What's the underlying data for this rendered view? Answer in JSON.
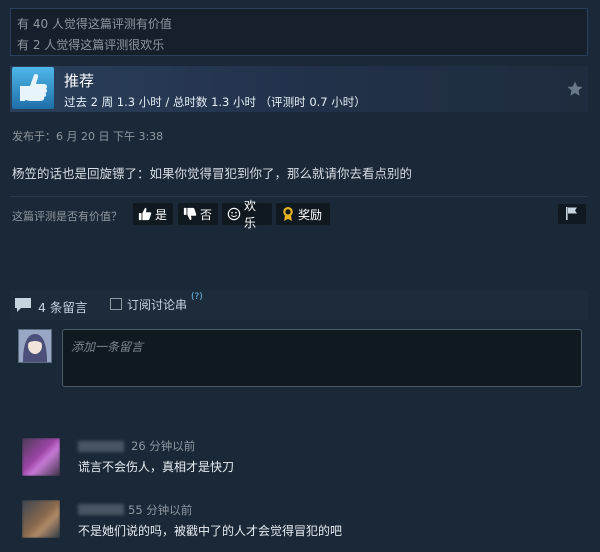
{
  "helpful_summary": {
    "line1": "有 40 人觉得这篇评测有价值",
    "line2": "有 2 人觉得这篇评测很欢乐"
  },
  "review": {
    "recommendation": "推荐",
    "hours": "过去 2 周 1.3 小时 / 总时数 1.3 小时 （评测时 0.7 小时）",
    "posted": "发布于：6 月 20 日 下午 3:38",
    "text": "杨笠的话也是回旋镖了：如果你觉得冒犯到你了，那么就请你去看点别的",
    "icons": {
      "thumb": "thumbs-up-icon",
      "award": "star-icon"
    }
  },
  "rating": {
    "question": "这篇评测是否有价值？",
    "yes": "是",
    "no": "否",
    "funny": "欢乐",
    "award": "奖励"
  },
  "comments": {
    "count_label": "4 条留言",
    "subscribe_label": "订阅讨论串",
    "help": "(?)",
    "input_placeholder": "添加一条留言",
    "items": [
      {
        "time": "26 分钟以前",
        "text": "谎言不会伤人，真相才是快刀"
      },
      {
        "time": "55 分钟以前",
        "text": "不是她们说的吗，被戳中了的人才会觉得冒犯的吧"
      }
    ]
  }
}
